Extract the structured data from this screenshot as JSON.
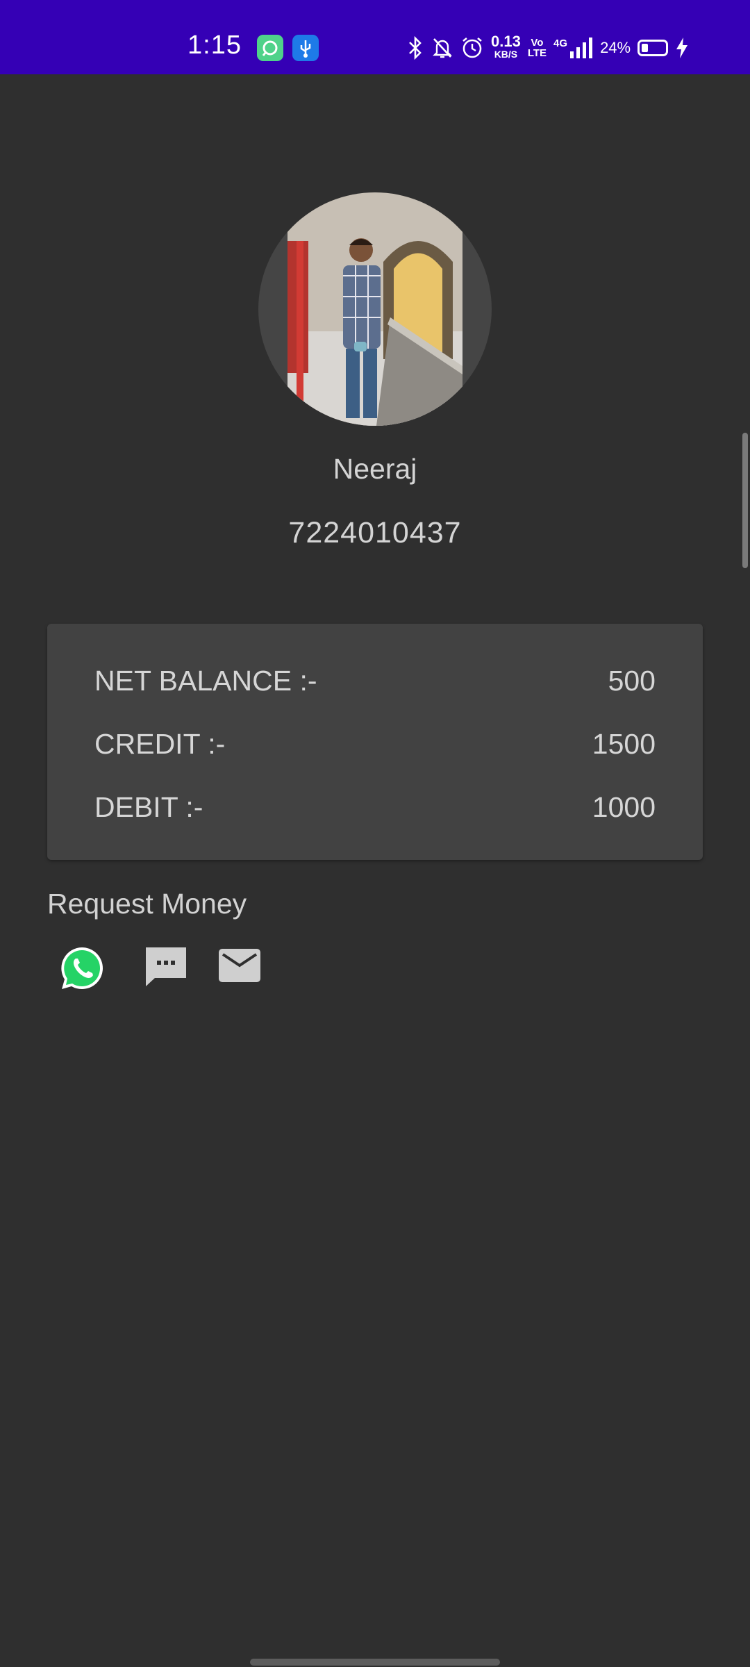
{
  "status_bar": {
    "time": "1:15",
    "net_speed": "0.13",
    "net_unit": "KB/S",
    "volte_top": "Vo",
    "volte_bottom": "LTE",
    "network": "4G",
    "battery": "24%",
    "icons": [
      "app-notification-icon",
      "usb-icon",
      "bluetooth-icon",
      "mute-icon",
      "alarm-icon",
      "signal-icon",
      "battery-icon",
      "charging-icon"
    ]
  },
  "profile": {
    "name": "Neeraj",
    "phone": "7224010437"
  },
  "balance": {
    "net_label": "NET BALANCE :-",
    "net_value": "500",
    "credit_label": "CREDIT :-",
    "credit_value": "1500",
    "debit_label": "DEBIT :-",
    "debit_value": "1000"
  },
  "request": {
    "title": "Request Money",
    "options": [
      "whatsapp-icon",
      "sms-icon",
      "email-icon"
    ]
  },
  "colors": {
    "status_bar": "#3500b5",
    "background": "#2f2f2f",
    "card": "#424242",
    "whatsapp": "#25d366"
  }
}
